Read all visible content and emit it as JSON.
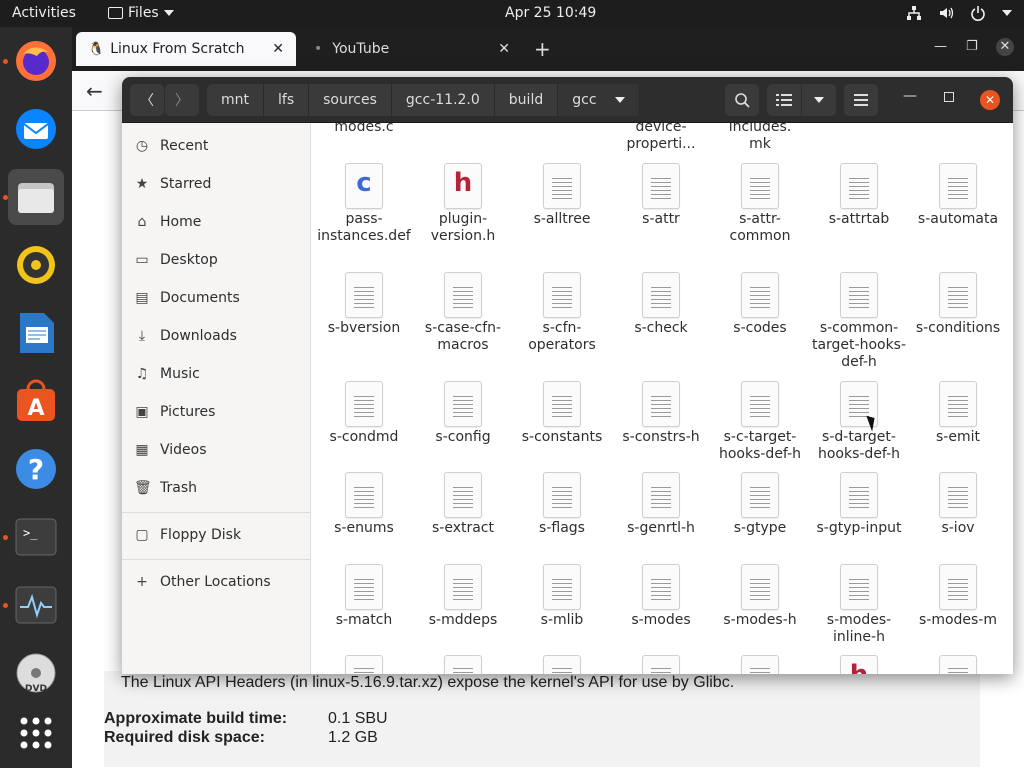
{
  "topbar": {
    "activities": "Activities",
    "app_menu": "Files",
    "clock": "Apr 25  10:49"
  },
  "dock": {
    "apps": [
      "firefox-icon",
      "thunderbird-icon",
      "files-icon",
      "rhythmbox-icon",
      "libreoffice-writer-icon",
      "ubuntu-software-icon",
      "help-icon",
      "terminal-icon",
      "system-monitor-icon",
      "dvd-icon",
      "show-applications-icon"
    ]
  },
  "browser": {
    "tabs": [
      {
        "label": "Linux From Scratch",
        "active": true
      },
      {
        "label": "YouTube",
        "active": false
      }
    ],
    "page": {
      "intro": "The Linux API Headers (in linux-5.16.9.tar.xz) expose the kernel's API for use by Glibc.",
      "build_time_label": "Approximate build time:",
      "build_time_value": "0.1 SBU",
      "disk_label": "Required disk space:",
      "disk_value": "1.2 GB"
    }
  },
  "files": {
    "path": [
      "mnt",
      "lfs",
      "sources",
      "gcc-11.2.0",
      "build",
      "gcc"
    ],
    "sidebar": {
      "places": [
        {
          "label": "Recent",
          "icon": "clock-icon"
        },
        {
          "label": "Starred",
          "icon": "star-icon"
        },
        {
          "label": "Home",
          "icon": "home-icon"
        },
        {
          "label": "Desktop",
          "icon": "desktop-icon"
        },
        {
          "label": "Documents",
          "icon": "documents-icon"
        },
        {
          "label": "Downloads",
          "icon": "download-icon"
        },
        {
          "label": "Music",
          "icon": "music-icon"
        },
        {
          "label": "Pictures",
          "icon": "pictures-icon"
        },
        {
          "label": "Videos",
          "icon": "videos-icon"
        },
        {
          "label": "Trash",
          "icon": "trash-icon"
        }
      ],
      "devices": [
        {
          "label": "Floppy Disk",
          "icon": "floppy-icon"
        }
      ],
      "other": {
        "label": "Other Locations",
        "icon": "plus-icon"
      }
    },
    "partial_top": [
      {
        "label": "modes.c"
      },
      {
        "label": "device-properti..."
      },
      {
        "label": "includes.\nmk"
      }
    ],
    "rows": [
      [
        {
          "label": "pass-instances.def",
          "type": "c"
        },
        {
          "label": "plugin-version.h",
          "type": "h"
        },
        {
          "label": "s-alltree",
          "type": "text"
        },
        {
          "label": "s-attr",
          "type": "text"
        },
        {
          "label": "s-attr-common",
          "type": "text"
        },
        {
          "label": "s-attrtab",
          "type": "text"
        },
        {
          "label": "s-automata",
          "type": "text"
        }
      ],
      [
        {
          "label": "s-bversion",
          "type": "text"
        },
        {
          "label": "s-case-cfn-macros",
          "type": "text"
        },
        {
          "label": "s-cfn-operators",
          "type": "text"
        },
        {
          "label": "s-check",
          "type": "text"
        },
        {
          "label": "s-codes",
          "type": "text"
        },
        {
          "label": "s-common-target-hooks-def-h",
          "type": "text"
        },
        {
          "label": "s-conditions",
          "type": "text"
        }
      ],
      [
        {
          "label": "s-condmd",
          "type": "text"
        },
        {
          "label": "s-config",
          "type": "text"
        },
        {
          "label": "s-constants",
          "type": "text"
        },
        {
          "label": "s-constrs-h",
          "type": "text"
        },
        {
          "label": "s-c-target-hooks-def-h",
          "type": "text"
        },
        {
          "label": "s-d-target-hooks-def-h",
          "type": "text"
        },
        {
          "label": "s-emit",
          "type": "text"
        }
      ],
      [
        {
          "label": "s-enums",
          "type": "text"
        },
        {
          "label": "s-extract",
          "type": "text"
        },
        {
          "label": "s-flags",
          "type": "text"
        },
        {
          "label": "s-genrtl-h",
          "type": "text"
        },
        {
          "label": "s-gtype",
          "type": "text"
        },
        {
          "label": "s-gtyp-input",
          "type": "text"
        },
        {
          "label": "s-iov",
          "type": "text"
        }
      ],
      [
        {
          "label": "s-match",
          "type": "text"
        },
        {
          "label": "s-mddeps",
          "type": "text"
        },
        {
          "label": "s-mlib",
          "type": "text"
        },
        {
          "label": "s-modes",
          "type": "text"
        },
        {
          "label": "s-modes-h",
          "type": "text"
        },
        {
          "label": "s-modes-inline-h",
          "type": "text"
        },
        {
          "label": "s-modes-m",
          "type": "text"
        }
      ]
    ],
    "colors": {
      "c_icon": "#3b6bd6",
      "h_icon": "#b5223a",
      "accent": "#e95420"
    }
  }
}
